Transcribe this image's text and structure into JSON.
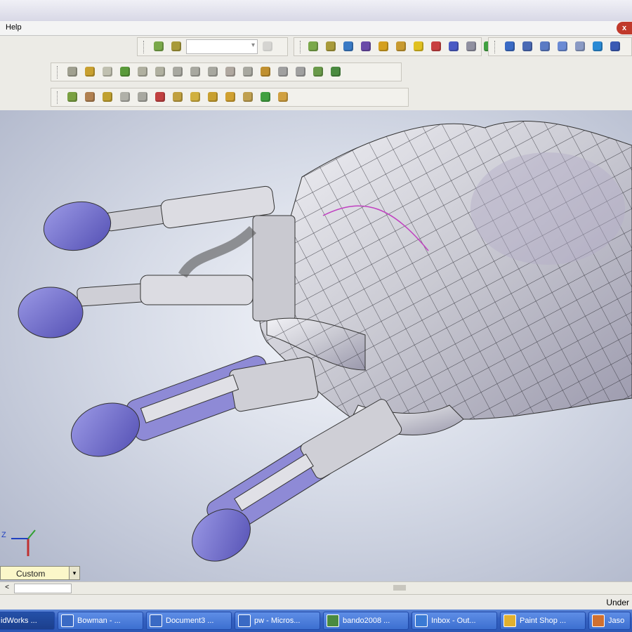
{
  "menu": {
    "help": "Help",
    "close": "x"
  },
  "toolbar": {
    "row1": [
      {
        "name": "mate-tool-icon",
        "color": "#7aa84a"
      },
      {
        "name": "insert-component-icon",
        "color": "#a89a3a"
      },
      {
        "name": "sketch-icon",
        "color": "#3a7ac4"
      },
      {
        "name": "smart-dimension-icon",
        "color": "#6a4aa8"
      },
      {
        "name": "relations-icon",
        "color": "#d4a020"
      },
      {
        "name": "grid-icon",
        "color": "#c89a30"
      },
      {
        "name": "check-icon",
        "color": "#e0c020"
      },
      {
        "name": "options-icon",
        "color": "#c84040"
      },
      {
        "name": "sum-icon",
        "color": "#4a5ac4"
      },
      {
        "name": "measure-icon",
        "color": "#9090a0"
      },
      {
        "name": "mass-props-icon",
        "color": "#40a040"
      },
      {
        "name": "section-props-icon",
        "color": "#c84040"
      }
    ],
    "row1_view": [
      {
        "name": "select-icon",
        "color": "#3a6ac4"
      },
      {
        "name": "zoom-fit-icon",
        "color": "#4a6ab4"
      },
      {
        "name": "zoom-area-icon",
        "color": "#5a7ac4"
      },
      {
        "name": "zoom-in-out-icon",
        "color": "#6a8ad4"
      },
      {
        "name": "zoom-selection-icon",
        "color": "#8a9ac4"
      },
      {
        "name": "rotate-icon",
        "color": "#2a8ad4"
      },
      {
        "name": "pan-icon",
        "color": "#3a5ab4"
      }
    ],
    "row2": [
      {
        "name": "new-part-icon",
        "color": "#a0a090"
      },
      {
        "name": "save-icon",
        "color": "#c8a030"
      },
      {
        "name": "line-icon",
        "color": "#c0c0b0"
      },
      {
        "name": "arc-icon",
        "color": "#5a9a3a"
      },
      {
        "name": "circle-icon",
        "color": "#b0b0a0"
      },
      {
        "name": "spline-icon",
        "color": "#b0b0a0"
      },
      {
        "name": "fillet-icon",
        "color": "#a8a8a0"
      },
      {
        "name": "chamfer-icon",
        "color": "#a8a8a0"
      },
      {
        "name": "offset-icon",
        "color": "#a8a8a0"
      },
      {
        "name": "mirror-icon",
        "color": "#b0a8a0"
      },
      {
        "name": "trim-icon",
        "color": "#a8a8a0"
      },
      {
        "name": "pattern-icon",
        "color": "#c09030"
      },
      {
        "name": "linear-pattern-icon",
        "color": "#a0a0a0"
      },
      {
        "name": "circular-pattern-icon",
        "color": "#a0a0a0"
      },
      {
        "name": "move-icon",
        "color": "#6a9a4a"
      },
      {
        "name": "ref-geometry-icon",
        "color": "#4a8a40"
      }
    ],
    "row3": [
      {
        "name": "extrude-icon",
        "color": "#7aa040"
      },
      {
        "name": "revolve-icon",
        "color": "#b08050"
      },
      {
        "name": "sweep-icon",
        "color": "#c0a030"
      },
      {
        "name": "loft-icon",
        "color": "#b0b0a8"
      },
      {
        "name": "boundary-icon",
        "color": "#a8a8a0"
      },
      {
        "name": "cut-icon",
        "color": "#c04040"
      },
      {
        "name": "hole-icon",
        "color": "#c0a040"
      },
      {
        "name": "shell-icon",
        "color": "#d0b040"
      },
      {
        "name": "rib-icon",
        "color": "#c8a030"
      },
      {
        "name": "draft-icon",
        "color": "#d0a030"
      },
      {
        "name": "dome-icon",
        "color": "#c0a050"
      },
      {
        "name": "feature-icon",
        "color": "#40a040"
      },
      {
        "name": "appearance-icon",
        "color": "#d0a040"
      }
    ]
  },
  "view_orientation": {
    "label": "Custom"
  },
  "triad": {
    "z": "Z"
  },
  "statusbar": {
    "text": "Under"
  },
  "taskbar": [
    {
      "label": "idWorks ...",
      "color": "#c03030",
      "active": true
    },
    {
      "label": "Bowman - ...",
      "color": "#3a6ac4",
      "active": false
    },
    {
      "label": "Document3 ...",
      "color": "#3a6ac4",
      "active": false
    },
    {
      "label": "pw - Micros...",
      "color": "#3a6ac4",
      "active": false
    },
    {
      "label": "bando2008 ...",
      "color": "#4a8a40",
      "active": false
    },
    {
      "label": "Inbox - Out...",
      "color": "#3a7ad4",
      "active": false
    },
    {
      "label": "Paint Shop ...",
      "color": "#e0b030",
      "active": false
    },
    {
      "label": "Jaso",
      "color": "#d07030",
      "active": false
    }
  ]
}
